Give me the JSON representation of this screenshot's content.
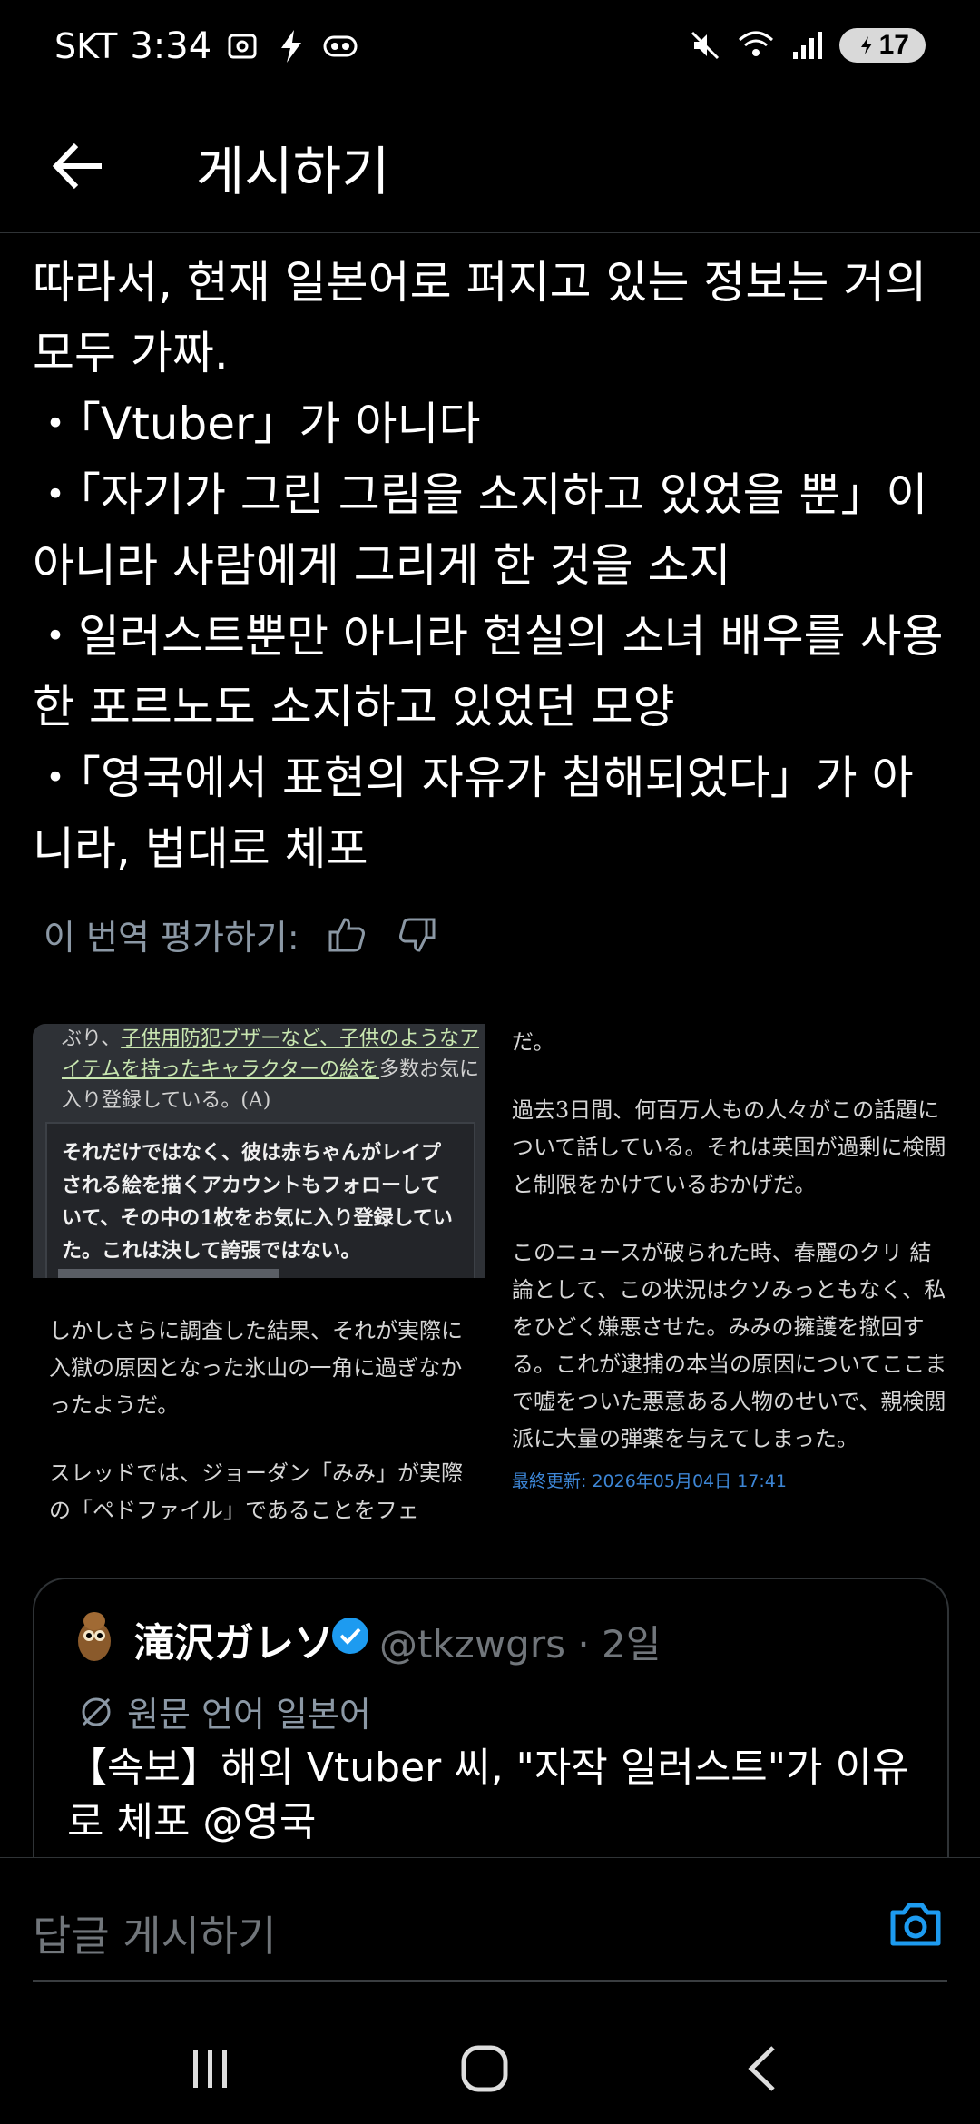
{
  "status": {
    "carrier": "SKT",
    "time": "3:34",
    "battery": "17"
  },
  "header": {
    "title": "게시하기"
  },
  "post": {
    "lines": [
      "따라서, 현재 일본어로 퍼지고 있는 정보는 거의 모두 가짜.",
      "・「Vtuber」가 아니다",
      "・「자기가 그린 그림을 소지하고 있었을 뿐」이 아니라 사람에게 그리게 한 것을 소지",
      "・일러스트뿐만 아니라 현실의 소녀 배우를 사용한 포르노도 소지하고 있었던 모양",
      "・「영국에서 표현의 자유가 침해되었다」가 아니라, 법대로 체포"
    ],
    "rate_label": "이 번역 평가하기:"
  },
  "media": {
    "shot_top_plain": "ぶり、",
    "shot_top_link": "子供用防犯ブザーなど、子供のようなアイテムを持ったキャラクターの絵を",
    "shot_top_tail": "多数お気に入り登録している。(A)",
    "shot_box": "それだけではなく、彼は赤ちゃんがレイプされる絵を描くアカウントもフォローしていて、その中の1枚をお気に入り登録していた。これは決して誇張ではない。",
    "col1": [
      "しかしさらに調査した結果、それが実際に入獄の原因となった氷山の一角に過ぎなかったようだ。",
      "スレッドでは、ジョーダン「みみ」が実際の「ペドファイル」であることをフェ"
    ],
    "col2": [
      "だ。",
      "過去3日間、何百万人もの人々がこの話題について話している。それは英国が過剰に検閲と制限をかけているおかげだ。",
      "このニュースが破られた時、春麗のクリ 結論として、この状況はクソみっともなく、私をひどく嫌悪させた。みみの擁護を撤回する。これが逮捕の本当の原因についてここまで嘘をついた悪意ある人物のせいで、親検閲派に大量の弾薬を与えてしまった。"
    ],
    "updated": "最終更新: 2026年05月04日 17:41"
  },
  "quote": {
    "name": "滝沢ガレソ",
    "handle": "@tkzwgrs · 2일",
    "lang_label": "원문 언어 일본어",
    "text": "【속보】해외 Vtuber 씨, \"자작 일러스트\"가 이유로 체포 @영국"
  },
  "reply": {
    "placeholder": "답글 게시하기"
  },
  "colors": {
    "background": "#000000",
    "accent": "#1d9bf0",
    "muted": "#71767b"
  }
}
